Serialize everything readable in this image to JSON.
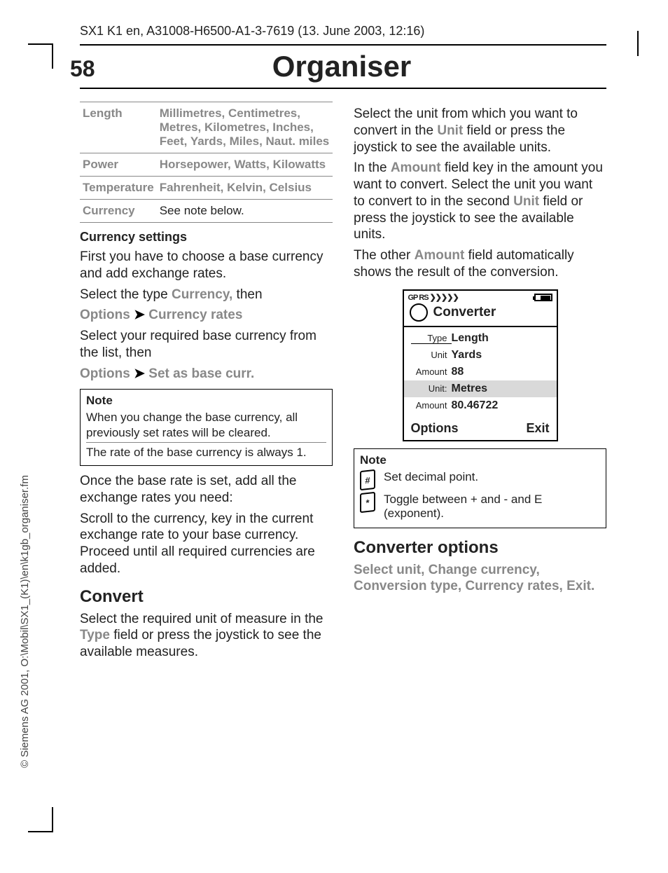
{
  "header": "SX1 K1 en, A31008-H6500-A1-3-7619 (13. June 2003, 12:16)",
  "page_number": "58",
  "title": "Organiser",
  "side_text": "© Siemens AG 2001, O:\\Mobil\\SX1_(K1)\\en\\k1gb_organiser.fm",
  "units_table": [
    {
      "k": "Length",
      "v": "Millimetres, Centimetres, Metres, Kilometres, Inches, Feet, Yards, Miles, Naut. miles",
      "gray": true
    },
    {
      "k": "Power",
      "v": "Horsepower, Watts, Kilowatts",
      "gray": true
    },
    {
      "k": "Temperature",
      "v": "Fahrenheit, Kelvin, Celsius",
      "gray": true
    },
    {
      "k": "Currency",
      "v": "See note below.",
      "gray": false
    }
  ],
  "left": {
    "h_currency": "Currency settings",
    "p1": "First you have to choose a base currency and add exchange rates.",
    "p2a": "Select the type ",
    "p2b": "Currency,",
    "p2c": " then",
    "opt1a": "Options",
    "arrow": "➤",
    "opt1b": "Currency rates",
    "p3": "Select your required base currency from the list, then",
    "opt2a": "Options",
    "opt2b": "Set as base curr.",
    "note_hd": "Note",
    "note_l1": "When you change the base currency, all previously set rates will be cleared.",
    "note_l2": "The rate of the base currency is always 1.",
    "p4": "Once the base rate is set, add all the exchange rates you need:",
    "p5": "Scroll to the currency, key in the current exchange rate to your base currency. Proceed until all required currencies are added.",
    "h_convert": "Convert",
    "p6a": "Select the required unit of measure in the ",
    "p6b": "Type",
    "p6c": " field or press the joystick to see the available measures."
  },
  "right": {
    "p1a": "Select the unit from which you want to convert in the ",
    "p1b": "Unit",
    "p1c": " field or press the joystick to see the available units.",
    "p2a": "In the ",
    "p2b": "Amount",
    "p2c": " field key in the amount you want to convert. Select the unit you want to convert to in the second ",
    "p2d": "Unit",
    "p2e": " field or press the joystick to see the available units.",
    "p3a": "The other ",
    "p3b": "Amount",
    "p3c": " field automatically shows the result of the conversion.",
    "note_hd": "Note",
    "key1": "#",
    "key1_txt": "Set decimal point.",
    "key2": "*",
    "key2_txt": "Toggle between + and - and E (exponent).",
    "h_convopt": "Converter options",
    "p4": "Select unit, Change currency, Conversion type, Currency rates, Exit."
  },
  "phone": {
    "signal": "GP RS ❯❯❯❯❯",
    "title": "Converter",
    "rows": [
      {
        "k": "Type",
        "v": "Length",
        "sel": false,
        "first": true
      },
      {
        "k": "Unit",
        "v": "Yards",
        "sel": false
      },
      {
        "k": "Amount",
        "v": "88",
        "sel": false
      },
      {
        "k": "Unit:",
        "v": "Metres",
        "sel": true
      },
      {
        "k": "Amount",
        "v": "80.46722",
        "sel": false
      }
    ],
    "left_soft": "Options",
    "right_soft": "Exit"
  }
}
